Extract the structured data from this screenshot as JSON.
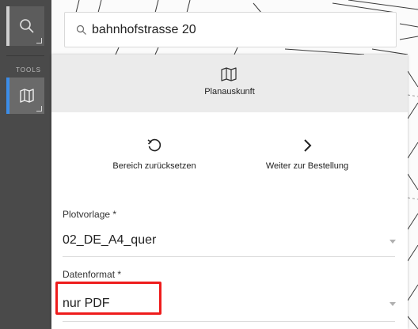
{
  "sidebar": {
    "section_label": "TOOLS",
    "tools": [
      {
        "icon": "search-icon"
      },
      {
        "icon": "map-icon"
      }
    ]
  },
  "search": {
    "value": "bahnhofstrasse 20",
    "icon": "search-icon"
  },
  "panel": {
    "title": "Planauskunft",
    "title_icon": "map-icon",
    "actions": [
      {
        "label": "Bereich zurücksetzen",
        "icon": "reset-icon"
      },
      {
        "label": "Weiter zur Bestellung",
        "icon": "chevron-right-icon"
      }
    ],
    "fields": {
      "plot_template": {
        "label": "Plotvorlage *",
        "value": "02_DE_A4_quer"
      },
      "data_format": {
        "label": "Datenformat *",
        "value": "nur PDF"
      }
    }
  },
  "colors": {
    "rail": "#4a4a4a",
    "active_accent": "#3c8de8",
    "highlight": "#ee1c1c"
  }
}
